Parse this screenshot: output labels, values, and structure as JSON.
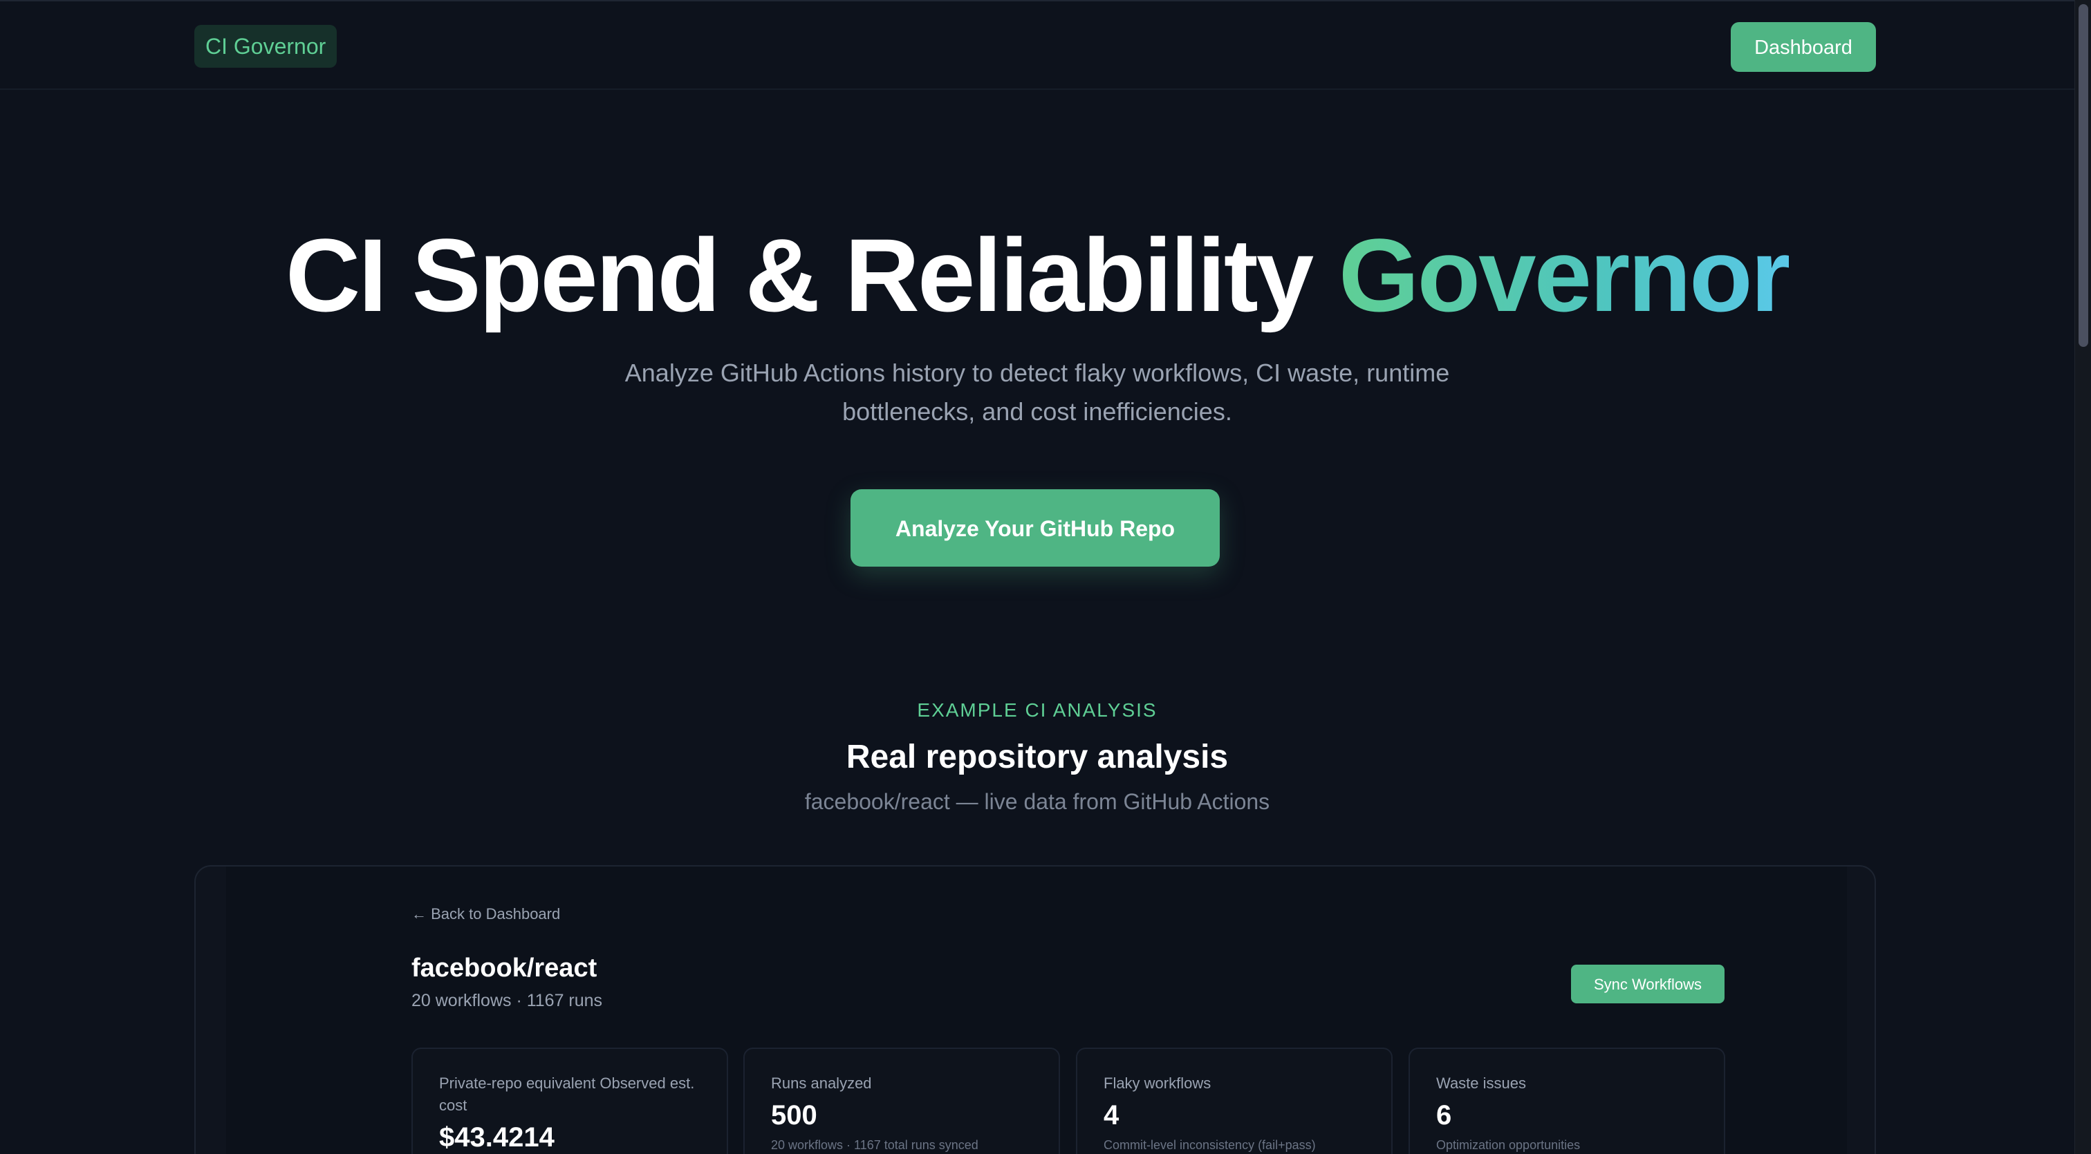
{
  "nav": {
    "logo": "CI Governor",
    "dashboard_label": "Dashboard"
  },
  "hero": {
    "title_main": "CI Spend & Reliability ",
    "title_accent": "Governor",
    "subtitle": "Analyze GitHub Actions history to detect flaky workflows, CI waste, runtime bottlenecks, and cost inefficiencies.",
    "cta_label": "Analyze Your GitHub Repo"
  },
  "section": {
    "eyebrow": "EXAMPLE CI ANALYSIS",
    "title": "Real repository analysis",
    "subtitle": "facebook/react — live data from GitHub Actions"
  },
  "preview": {
    "back_label": "← Back to Dashboard",
    "repo_name": "facebook/react",
    "repo_meta": "20 workflows · 1167 runs",
    "sync_label": "Sync Workflows",
    "cards": [
      {
        "label": "Private-repo equivalent Observed est. cost",
        "value": "$43.4214",
        "note": ""
      },
      {
        "label": "Runs analyzed",
        "value": "500",
        "note": "20 workflows · 1167 total runs synced"
      },
      {
        "label": "Flaky workflows",
        "value": "4",
        "note": "Commit-level inconsistency (fail+pass)"
      },
      {
        "label": "Waste issues",
        "value": "6",
        "note": "Optimization opportunities"
      }
    ]
  },
  "colors": {
    "background": "#0d121c",
    "accent": "#4fb584",
    "accent_text": "#5fcf95",
    "gradient_end": "#5ac8e8"
  }
}
